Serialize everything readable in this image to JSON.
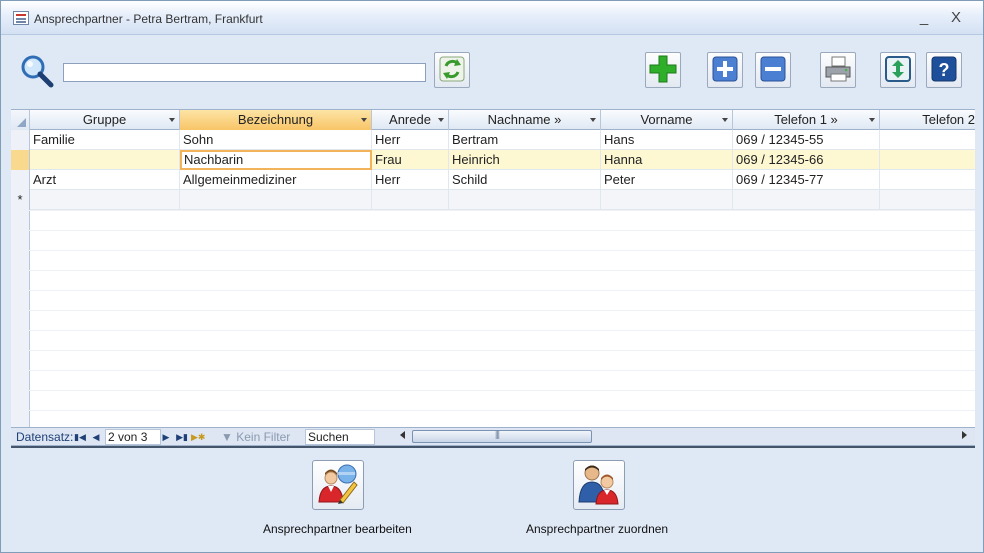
{
  "window": {
    "title": "Ansprechpartner - Petra Bertram, Frankfurt",
    "minimize": "_",
    "close": "X"
  },
  "search": {
    "value": "",
    "placeholder": ""
  },
  "grid": {
    "columns": [
      "Gruppe",
      "Bezeichnung",
      "Anrede",
      "Nachname »",
      "Vorname",
      "Telefon 1 »",
      "Telefon 2"
    ],
    "rows": [
      [
        "Familie",
        "Sohn",
        "Herr",
        "Bertram",
        "Hans",
        "069 / 12345-55",
        ""
      ],
      [
        "",
        "Nachbarin",
        "Frau",
        "Heinrich",
        "Hanna",
        "069 / 12345-66",
        ""
      ],
      [
        "Arzt",
        "Allgemeinmediziner",
        "Herr",
        "Schild",
        "Peter",
        "069 / 12345-77",
        ""
      ]
    ],
    "new_row_marker": "*"
  },
  "navigation": {
    "label": "Datensatz:",
    "position": "2 von 3",
    "filter": "Kein Filter",
    "search": "Suchen"
  },
  "footer": {
    "edit_label": "Ansprechpartner bearbeiten",
    "assign_label": "Ansprechpartner zuordnen"
  }
}
